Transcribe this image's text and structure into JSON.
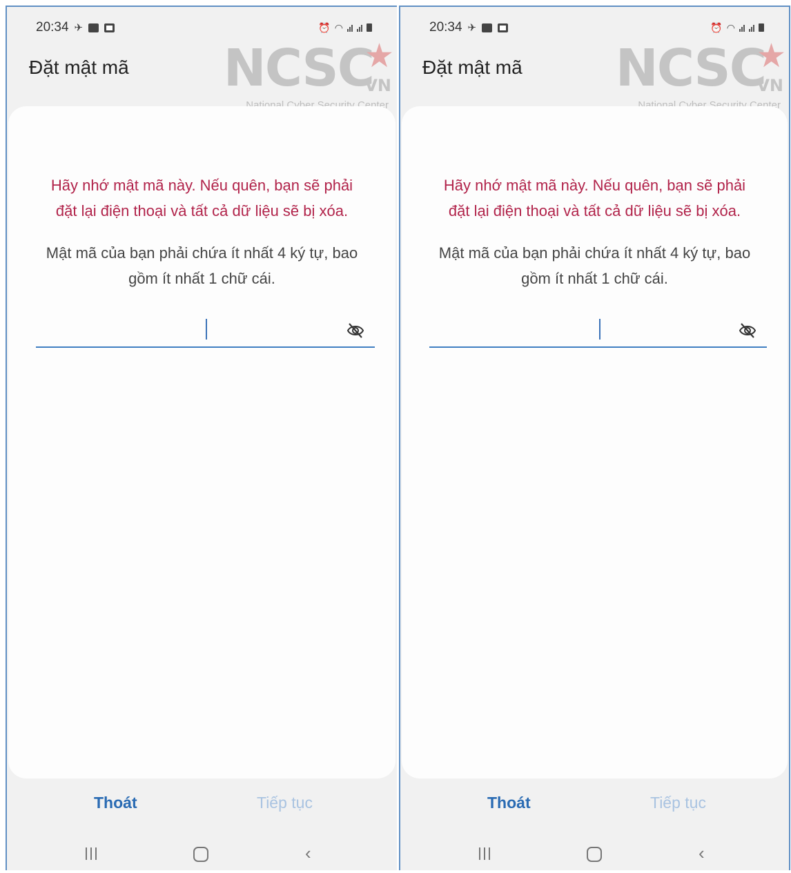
{
  "screens": [
    {
      "status_time": "20:34",
      "title": "Đặt mật mã",
      "logo": {
        "main": "NCSC",
        "vn": "VN",
        "sub": "National Cyber Security Center"
      },
      "warning_line1": "Hãy nhớ mật mã này. Nếu quên, bạn sẽ phải",
      "warning_line2": "đặt lại điện thoại và tất cả dữ liệu sẽ bị xóa.",
      "hint_line1": "Mật mã của bạn phải chứa ít nhất 4 ký tự, bao",
      "hint_line2": "gồm ít nhất 1 chữ cái.",
      "password_value": "",
      "exit_label": "Thoát",
      "next_label": "Tiếp tục"
    },
    {
      "status_time": "20:34",
      "title": "Đặt mật mã",
      "logo": {
        "main": "NCSC",
        "vn": "VN",
        "sub": "National Cyber Security Center"
      },
      "warning_line1": "Hãy nhớ mật mã này. Nếu quên, bạn sẽ phải",
      "warning_line2": "đặt lại điện thoại và tất cả dữ liệu sẽ bị xóa.",
      "hint_line1": "Mật mã của bạn phải chứa ít nhất 4 ký tự, bao",
      "hint_line2": "gồm ít nhất 1 chữ cái.",
      "password_value": "",
      "exit_label": "Thoát",
      "next_label": "Tiếp tục"
    }
  ],
  "colors": {
    "warning": "#b1234a",
    "accent": "#2a6bb3",
    "disabled_accent": "#a9c3e1",
    "background": "#f1f1f1"
  },
  "icons": {
    "status": [
      "location-pin-icon",
      "message-icon",
      "calendar-icon",
      "alarm-icon",
      "wifi-icon",
      "signal-icon",
      "battery-icon"
    ],
    "field": "eye-off-icon",
    "nav": [
      "recents-icon",
      "home-icon",
      "back-icon"
    ]
  }
}
